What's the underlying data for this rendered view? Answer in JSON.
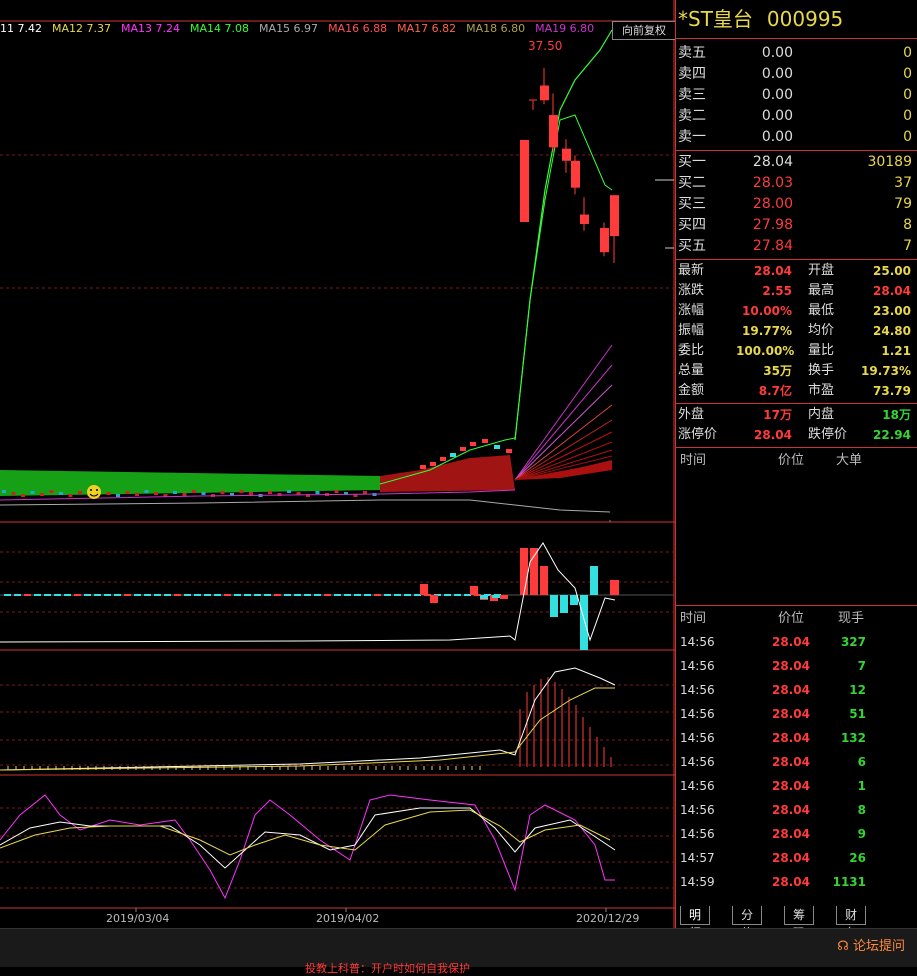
{
  "ma_legend": [
    {
      "label": "11 7.42",
      "color": "#ffffff"
    },
    {
      "label": "MA12 7.37",
      "color": "#e8d84a"
    },
    {
      "label": "MA13 7.24",
      "color": "#ff33ff"
    },
    {
      "label": "MA14 7.08",
      "color": "#33ff33"
    },
    {
      "label": "MA15 6.97",
      "color": "#aaaaaa"
    },
    {
      "label": "MA16 6.88",
      "color": "#ff5555"
    },
    {
      "label": "MA17 6.82",
      "color": "#ff6644"
    },
    {
      "label": "MA18 6.80",
      "color": "#b0a050"
    },
    {
      "label": "MA19 6.80",
      "color": "#cc33cc"
    }
  ],
  "chart": {
    "fq_button": "向前复权",
    "high_label": "37.50",
    "dates": [
      "2019/03/04",
      "2019/04/02",
      "2020/12/29"
    ],
    "candles": [
      {
        "o": 36.2,
        "h": 37.5,
        "l": 34.8,
        "c": 35.1
      },
      {
        "o": 34.0,
        "h": 35.6,
        "l": 31.3,
        "c": 31.6
      },
      {
        "o": 31.5,
        "h": 32.2,
        "l": 29.7,
        "c": 30.6
      },
      {
        "o": 30.6,
        "h": 31.0,
        "l": 28.1,
        "c": 28.6
      },
      {
        "o": 26.6,
        "h": 27.9,
        "l": 25.4,
        "c": 25.9
      },
      {
        "o": 25.6,
        "h": 26.0,
        "l": 23.5,
        "c": 23.8
      },
      {
        "o": 25.0,
        "h": 28.04,
        "l": 23.0,
        "c": 28.04
      }
    ]
  },
  "colors": {
    "up": "#ff3b3b",
    "down": "#33e0e0",
    "ma_green": "#33dd33",
    "ma_red": "#cc1111"
  },
  "stock": {
    "name": "*ST皇台",
    "code": "000995"
  },
  "asks": [
    {
      "label": "卖五",
      "price": "0.00",
      "vol": "0"
    },
    {
      "label": "卖四",
      "price": "0.00",
      "vol": "0"
    },
    {
      "label": "卖三",
      "price": "0.00",
      "vol": "0"
    },
    {
      "label": "卖二",
      "price": "0.00",
      "vol": "0"
    },
    {
      "label": "卖一",
      "price": "0.00",
      "vol": "0"
    }
  ],
  "bids": [
    {
      "label": "买一",
      "price": "28.04",
      "vol": "30189"
    },
    {
      "label": "买二",
      "price": "28.03",
      "vol": "37"
    },
    {
      "label": "买三",
      "price": "28.00",
      "vol": "79"
    },
    {
      "label": "买四",
      "price": "27.98",
      "vol": "8"
    },
    {
      "label": "买五",
      "price": "27.84",
      "vol": "7"
    }
  ],
  "stats": [
    {
      "l1": "最新",
      "v1": "28.04",
      "c1": "red",
      "l2": "开盘",
      "v2": "25.00",
      "c2": "yellow"
    },
    {
      "l1": "涨跌",
      "v1": "2.55",
      "c1": "red",
      "l2": "最高",
      "v2": "28.04",
      "c2": "red"
    },
    {
      "l1": "涨幅",
      "v1": "10.00%",
      "c1": "red",
      "l2": "最低",
      "v2": "23.00",
      "c2": "yellow"
    },
    {
      "l1": "振幅",
      "v1": "19.77%",
      "c1": "yellow",
      "l2": "均价",
      "v2": "24.80",
      "c2": "yellow"
    },
    {
      "l1": "委比",
      "v1": "100.00%",
      "c1": "yellow",
      "l2": "量比",
      "v2": "1.21",
      "c2": "yellow"
    },
    {
      "l1": "总量",
      "v1": "35万",
      "c1": "yellow",
      "l2": "换手",
      "v2": "19.73%",
      "c2": "yellow"
    },
    {
      "l1": "金额",
      "v1": "8.7亿",
      "c1": "red",
      "l2": "市盈",
      "v2": "73.79",
      "c2": "yellow"
    }
  ],
  "stats2": [
    {
      "l1": "外盘",
      "v1": "17万",
      "c1": "red",
      "l2": "内盘",
      "v2": "18万",
      "c2": "green"
    },
    {
      "l1": "涨停价",
      "v1": "28.04",
      "c1": "red",
      "l2": "跌停价",
      "v2": "22.94",
      "c2": "green"
    }
  ],
  "big_header": {
    "time": "时间",
    "price": "价位",
    "big": "大单"
  },
  "trades_header": {
    "time": "时间",
    "price": "价位",
    "vol": "现手"
  },
  "trades": [
    {
      "t": "14:56",
      "p": "28.04",
      "v": "327"
    },
    {
      "t": "14:56",
      "p": "28.04",
      "v": "7"
    },
    {
      "t": "14:56",
      "p": "28.04",
      "v": "12"
    },
    {
      "t": "14:56",
      "p": "28.04",
      "v": "51"
    },
    {
      "t": "14:56",
      "p": "28.04",
      "v": "132"
    },
    {
      "t": "14:56",
      "p": "28.04",
      "v": "6"
    },
    {
      "t": "14:56",
      "p": "28.04",
      "v": "1"
    },
    {
      "t": "14:56",
      "p": "28.04",
      "v": "8"
    },
    {
      "t": "14:56",
      "p": "28.04",
      "v": "9"
    },
    {
      "t": "14:57",
      "p": "28.04",
      "v": "26"
    },
    {
      "t": "14:59",
      "p": "28.04",
      "v": "1131"
    }
  ],
  "tabs": [
    "明细",
    "分价",
    "筹码",
    "财务"
  ],
  "forum": "论坛提问",
  "ticker": "投教上科普：开户时如何自我保护"
}
